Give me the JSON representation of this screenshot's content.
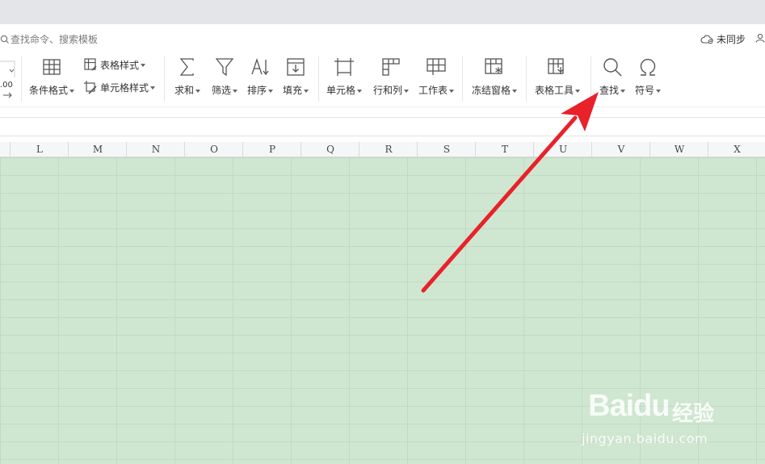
{
  "search": {
    "placeholder": "查找命令、搜索模板"
  },
  "sync": {
    "label": "未同步"
  },
  "ribbon": {
    "conditional_format": "条件格式",
    "table_style": "表格样式",
    "cell_style": "单元格样式",
    "sum": "求和",
    "filter": "筛选",
    "sort": "排序",
    "fill": "填充",
    "cell": "单元格",
    "row_col": "行和列",
    "worksheet": "工作表",
    "freeze": "冻结窗格",
    "table_tools": "表格工具",
    "find": "查找",
    "symbol": "符号",
    "decimal_hint": ".00"
  },
  "columns": [
    "L",
    "M",
    "N",
    "O",
    "P",
    "Q",
    "R",
    "S",
    "T",
    "U",
    "V",
    "W",
    "X"
  ],
  "watermark": {
    "brand": "Bai",
    "brand2": "du",
    "cn": "经验",
    "url": "jingyan.baidu.com"
  },
  "colors": {
    "grid_bg": "#cfe6d0",
    "arrow": "#e8212b",
    "top_strip": "#e4e5e8"
  }
}
